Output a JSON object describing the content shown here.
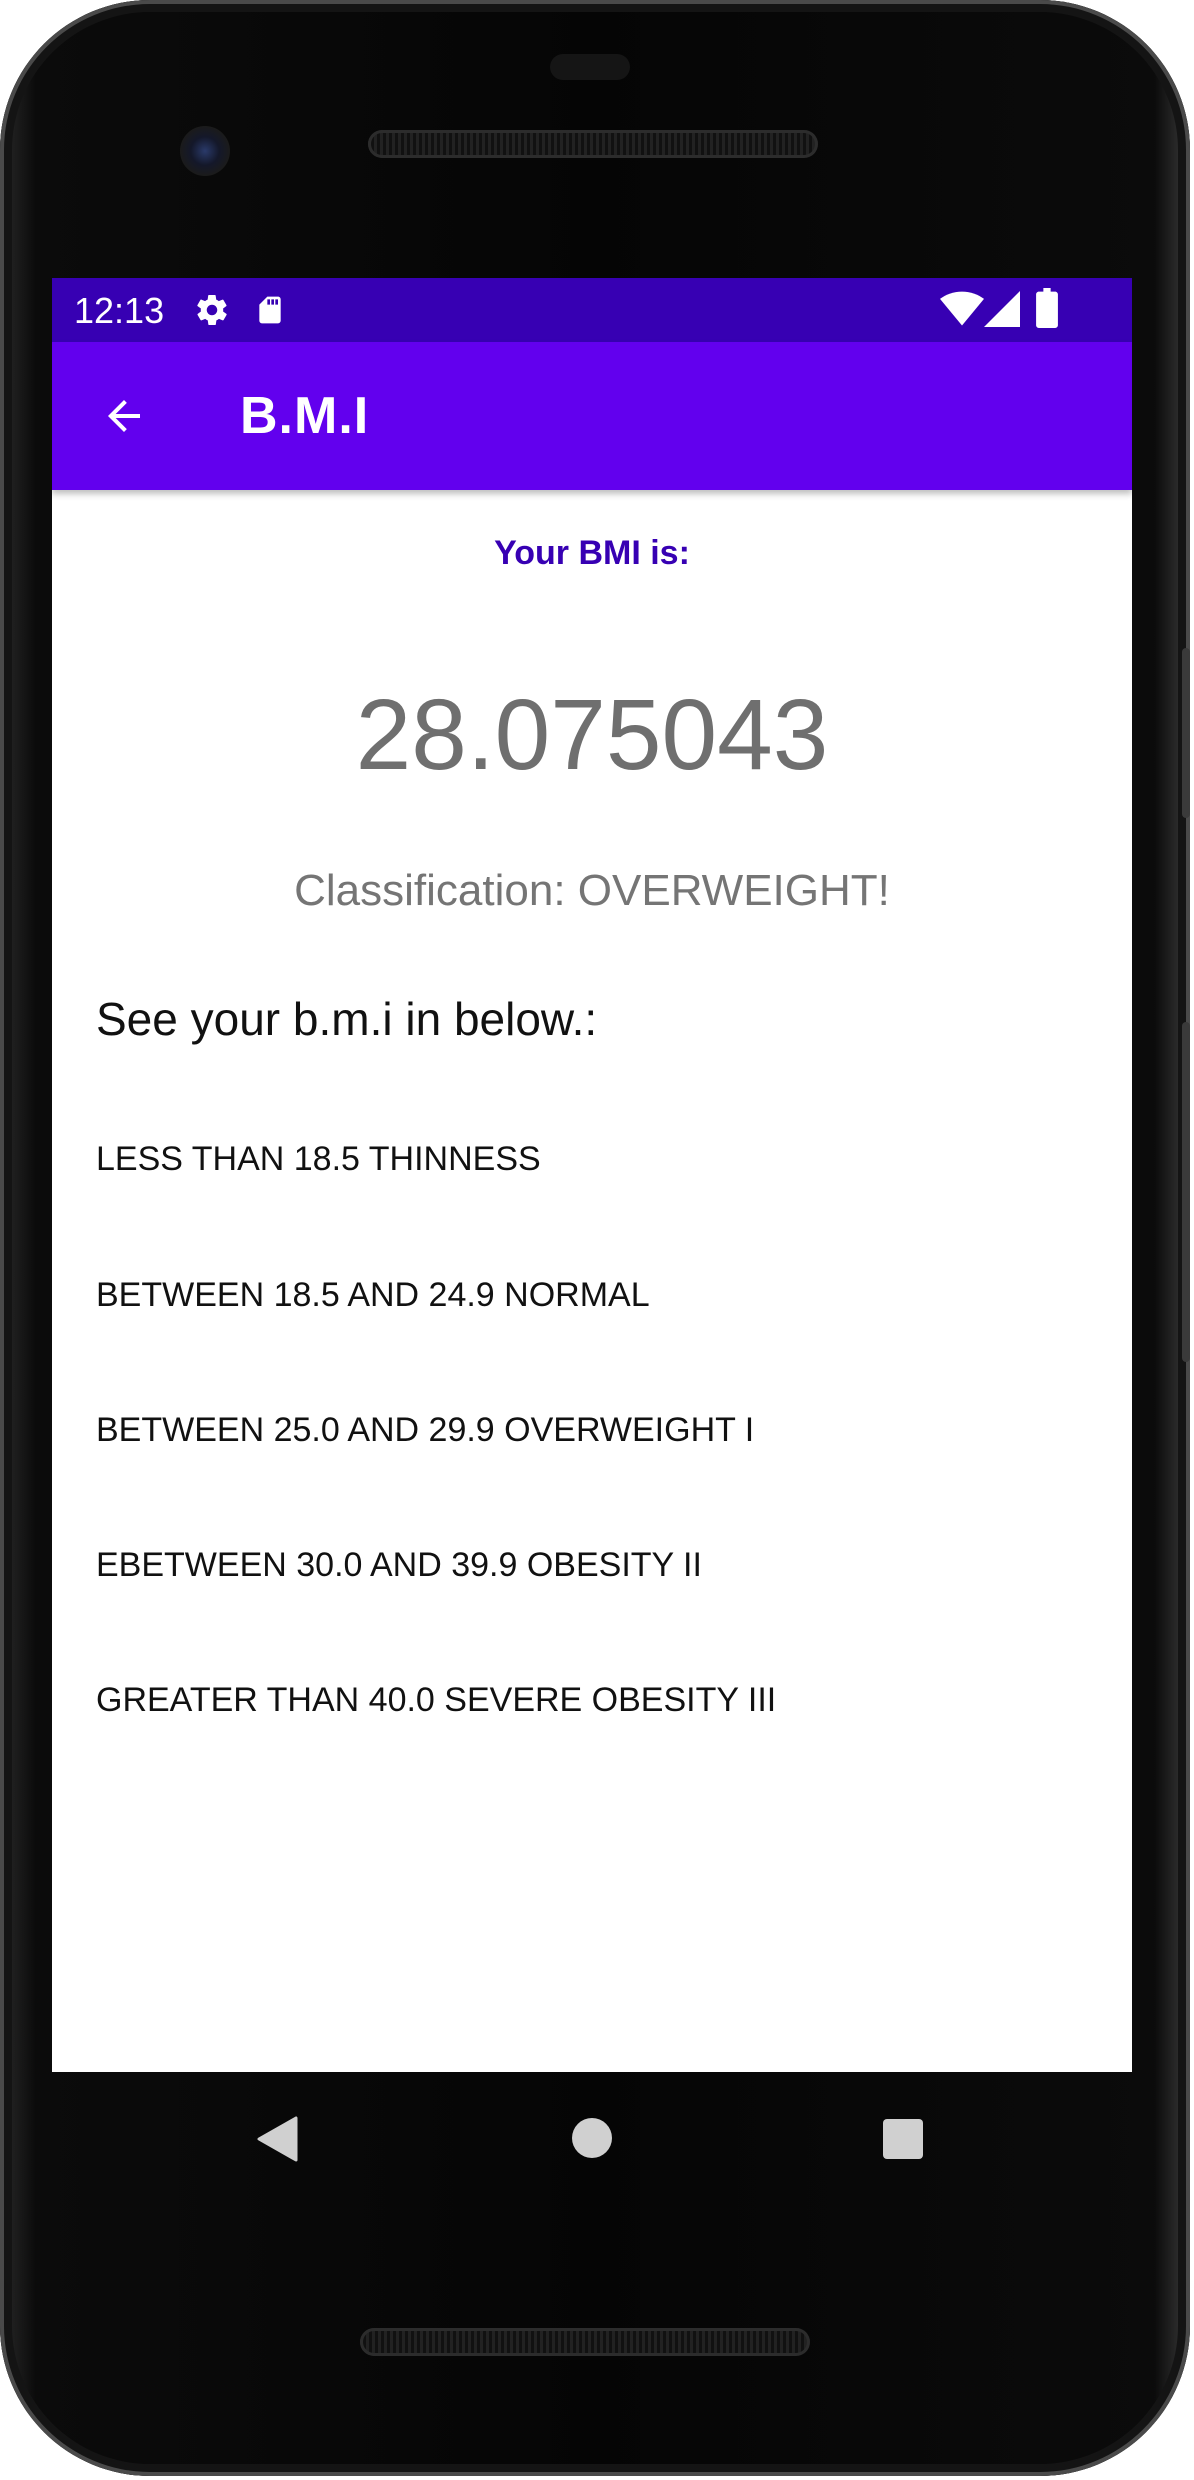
{
  "status_bar": {
    "time": "12:13",
    "left_icons": [
      "settings-icon",
      "sd-card-icon"
    ],
    "right_icons": [
      "wifi-icon",
      "signal-icon",
      "battery-icon"
    ]
  },
  "app_bar": {
    "title": "B.M.I",
    "back_icon": "arrow-back-icon"
  },
  "result": {
    "label": "Your BMI is:",
    "value": "28.075043",
    "classification": "Classification: OVERWEIGHT!"
  },
  "reference": {
    "heading": "See your b.m.i in below.:",
    "ranges": [
      "LESS THAN 18.5 THINNESS",
      "BETWEEN 18.5 AND 24.9 NORMAL",
      "BETWEEN 25.0 AND 29.9 OVERWEIGHT I",
      "EBETWEEN 30.0 AND 39.9 OBESITY II",
      "GREATER THAN 40.0 SEVERE OBESITY III"
    ]
  },
  "nav_bar": {
    "buttons": [
      "back-triangle-icon",
      "home-circle-icon",
      "recents-square-icon"
    ]
  },
  "colors": {
    "status_bar": "#3700b3",
    "app_bar": "#6200ee",
    "label_text": "#3700b3",
    "value_text": "#6f6f6f"
  }
}
